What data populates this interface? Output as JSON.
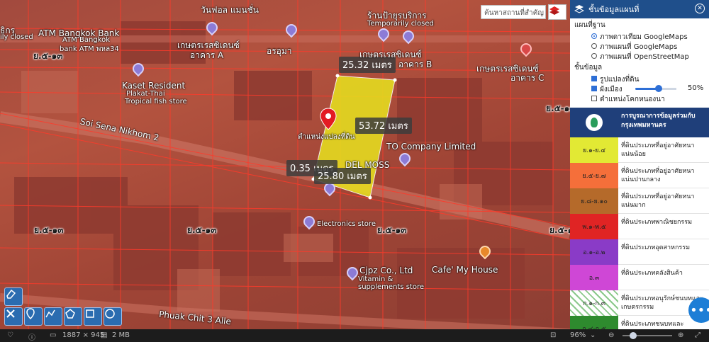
{
  "search": {
    "placeholder": "ค้นหาสถานที่สำคัญ"
  },
  "panel": {
    "title": "ชั้นข้อมูลแผนที่",
    "basemap_title": "แผนที่ฐาน",
    "basemap_options": [
      {
        "label": "ภาพดาวเทียม GoogleMaps",
        "selected": true
      },
      {
        "label": "ภาพแผนที่ GoogleMaps",
        "selected": false
      },
      {
        "label": "ภาพแผนที่ OpenStreetMap",
        "selected": false
      }
    ],
    "layers_title": "ชั้นข้อมูล",
    "layers": [
      {
        "label": "รูปแปลงที่ดิน",
        "checked": true
      },
      {
        "label": "ผังเมือง",
        "checked": true
      },
      {
        "label": "ตำแหน่งโคกหนองนา",
        "checked": false
      }
    ],
    "opacity_value": "50%",
    "legend_title": "การบูรณาการข้อมูลร่วมกับ กรุงเทพมหานคร",
    "legend": [
      {
        "code": "ย.๑-ย.๔",
        "desc": "ที่ดินประเภทที่อยู่อาศัยหนาแน่นน้อย",
        "color": "#e2e934"
      },
      {
        "code": "ย.๕-ย.๗",
        "desc": "ที่ดินประเภทที่อยู่อาศัยหนาแน่นปานกลาง",
        "color": "#f56f3a"
      },
      {
        "code": "ย.๘-ย.๑๐",
        "desc": "ที่ดินประเภทที่อยู่อาศัยหนาแน่นมาก",
        "color": "#b56a2a"
      },
      {
        "code": "พ.๑-พ.๕",
        "desc": "ที่ดินประเภทพาณิชยกรรม",
        "color": "#e02424"
      },
      {
        "code": "อ.๑-อ.๒",
        "desc": "ที่ดินประเภทอุตสาหกรรม",
        "color": "#8a3bc7"
      },
      {
        "code": "อ.๓",
        "desc": "ที่ดินประเภทคลังสินค้า",
        "color": "#cf47d6"
      },
      {
        "code": "ก.๑-ก.๓",
        "desc": "ที่ดินประเภทอนุรักษ์ชนบทและเกษตรกรรม",
        "color": "#cfe8cf"
      },
      {
        "code": "ก.๔-ก.๕",
        "desc": "ที่ดินประเภทชนบทและ",
        "color": "#2e8b2e"
      }
    ]
  },
  "map": {
    "measures": [
      "25.32 เมตร",
      "53.72 เมตร",
      "0.35 เมตร",
      "25.80 เมตร"
    ],
    "marker_label": "ตำแหน่งแปลงที่ดิน",
    "labels": [
      "วันฟอล แมนชั่น",
      "ร้านป้ายุรบริการ",
      "Temporarily closed",
      "ธิกรุ",
      "ily closed",
      "ATM Bangkok Bank",
      "ATM Bangkok",
      "bank ATM พหล34",
      "เกษตรเรสซิเดนซ์",
      "อาคาร A",
      "อรอุมา",
      "เกษตรเรสซิเดนซ์",
      "อาคาร B",
      "เกษตรเรสซิเดนซ์",
      "อาคาร C",
      "Kaset Resident",
      "Plakat-Thai",
      "Tropical fish store",
      "Soi Sena Nikhom 2",
      "TO Company Limited",
      "DEL MOSS",
      "Electronics store",
      "Cjpz Co., Ltd",
      "Vitamin &",
      "supplements store",
      "Cafe' My House",
      "Phuak Chit 3 Alle"
    ],
    "zone_codes": [
      "ย.๕-๑๓",
      "ย.๕-๑๓",
      "ย.๕-๑๓",
      "ย.๕-๑๓",
      "ย.๕-๑๓",
      "ย.๕-๑๓"
    ]
  },
  "bottombar": {
    "dimensions": "1887 × 945",
    "filesize": "2 MB",
    "zoom": "96%"
  },
  "colors": {
    "panel_header": "#1f4f8b",
    "parcel": "#e6df1f",
    "accent": "#2e6fd6"
  }
}
